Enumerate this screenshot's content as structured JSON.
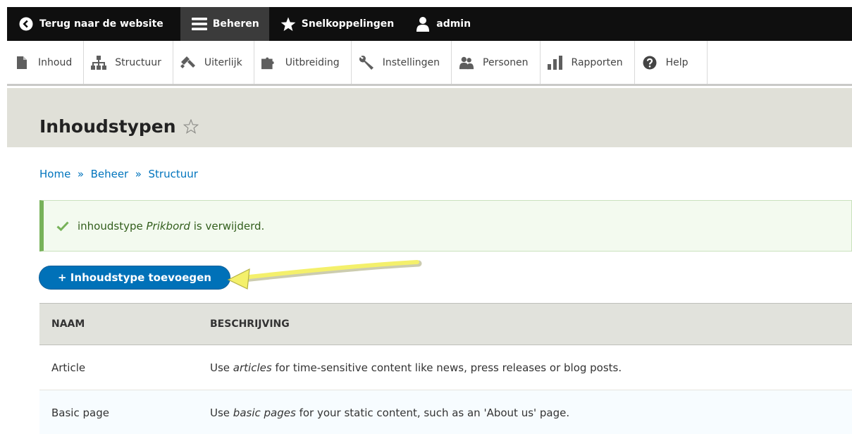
{
  "toolbar": {
    "back_label": "Terug naar de website",
    "manage_label": "Beheren",
    "shortcuts_label": "Snelkoppelingen",
    "user_label": "admin"
  },
  "tray": {
    "items": [
      {
        "label": "Inhoud",
        "icon": "file-icon"
      },
      {
        "label": "Structuur",
        "icon": "sitemap-icon"
      },
      {
        "label": "Uiterlijk",
        "icon": "paintbrush-icon"
      },
      {
        "label": "Uitbreiding",
        "icon": "puzzle-icon"
      },
      {
        "label": "Instellingen",
        "icon": "wrench-icon"
      },
      {
        "label": "Personen",
        "icon": "people-icon"
      },
      {
        "label": "Rapporten",
        "icon": "bar-chart-icon"
      },
      {
        "label": "Help",
        "icon": "help-icon"
      }
    ]
  },
  "page": {
    "title": "Inhoudstypen"
  },
  "breadcrumb": {
    "home": "Home",
    "admin": "Beheer",
    "structure": "Structuur",
    "separator": "»"
  },
  "message": {
    "prefix": "inhoudstype ",
    "name": "Prikbord",
    "suffix": " is verwijderd."
  },
  "add_button": {
    "label": "+ Inhoudstype toevoegen"
  },
  "table": {
    "headers": {
      "name": "NAAM",
      "description": "BESCHRIJVING"
    },
    "rows": [
      {
        "name": "Article",
        "desc_pre": "Use ",
        "desc_em": "articles",
        "desc_post": " for time-sensitive content like news, press releases or blog posts."
      },
      {
        "name": "Basic page",
        "desc_pre": "Use ",
        "desc_em": "basic pages",
        "desc_post": " for your static content, such as an 'About us' page."
      }
    ]
  },
  "colors": {
    "toolbar_bg": "#0f0f0f",
    "link": "#0074bd",
    "primary_button": "#0071b8",
    "success_border": "#77b259",
    "arrow": "#f4f06b"
  }
}
